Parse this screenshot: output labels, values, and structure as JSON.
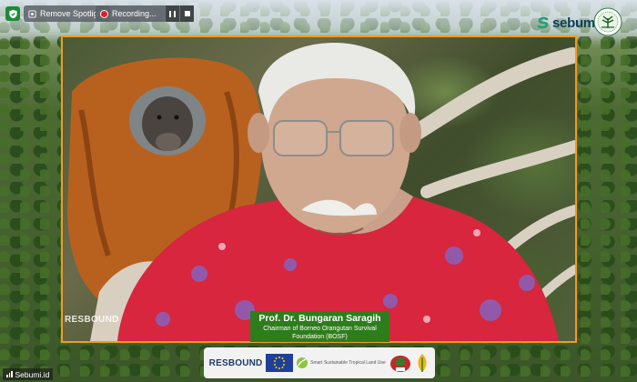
{
  "toolbar": {
    "remove_spotlight": "Remove Spotlight",
    "recording": "Recording..."
  },
  "brand": {
    "sebumi": "sebumi"
  },
  "caption": {
    "name": "Prof. Dr. Bungaran Saragih",
    "title": "Chairman of Borneo Orangutan Survival Foundation (BOSF)"
  },
  "watermark": {
    "resbound": "RESBOUND"
  },
  "sponsors": {
    "resbound": "RESBOUND",
    "smart_text": "Smart Sustainable Tropical Land Use"
  },
  "participant": {
    "name": "Sebumi.id"
  },
  "colors": {
    "frame_border": "#f39a1d",
    "caption_bg": "#2e7d1c",
    "recording_dot": "#e02020"
  }
}
